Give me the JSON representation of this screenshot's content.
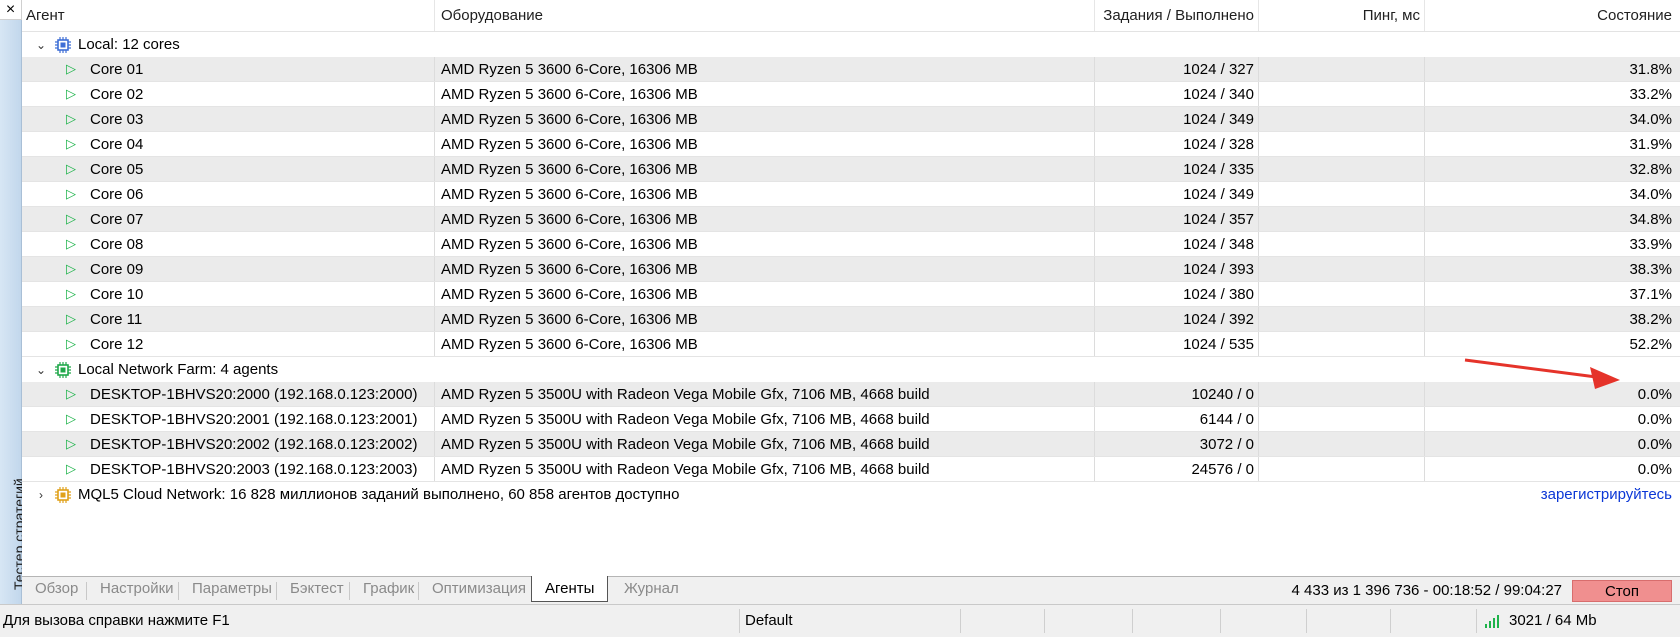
{
  "window": {
    "side_title": "Тестер стратегий",
    "close_glyph": "×"
  },
  "columns": {
    "agent": "Агент",
    "hardware": "Оборудование",
    "jobs": "Задания / Выполнено",
    "ping": "Пинг, мс",
    "state": "Состояние"
  },
  "groups": {
    "local": {
      "label": "Local: 12 cores",
      "icon": "cpu-chip-icon",
      "color": "#3f6fd6"
    },
    "farm": {
      "label": "Local Network Farm: 4 agents",
      "icon": "cpu-chip-icon",
      "color": "#20a84a"
    },
    "cloud": {
      "label": "MQL5 Cloud Network: 16 828 миллионов заданий выполнено, 60 858 агентов доступно",
      "icon": "cpu-chip-icon",
      "color": "#e0a11a",
      "link": "зарегистрируйтесь"
    }
  },
  "local_agents": [
    {
      "name": "Core 01",
      "hw": "AMD Ryzen 5 3600 6-Core, 16306 MB",
      "jobs": "1024 / 327",
      "ping": "",
      "state": "31.8%"
    },
    {
      "name": "Core 02",
      "hw": "AMD Ryzen 5 3600 6-Core, 16306 MB",
      "jobs": "1024 / 340",
      "ping": "",
      "state": "33.2%"
    },
    {
      "name": "Core 03",
      "hw": "AMD Ryzen 5 3600 6-Core, 16306 MB",
      "jobs": "1024 / 349",
      "ping": "",
      "state": "34.0%"
    },
    {
      "name": "Core 04",
      "hw": "AMD Ryzen 5 3600 6-Core, 16306 MB",
      "jobs": "1024 / 328",
      "ping": "",
      "state": "31.9%"
    },
    {
      "name": "Core 05",
      "hw": "AMD Ryzen 5 3600 6-Core, 16306 MB",
      "jobs": "1024 / 335",
      "ping": "",
      "state": "32.8%"
    },
    {
      "name": "Core 06",
      "hw": "AMD Ryzen 5 3600 6-Core, 16306 MB",
      "jobs": "1024 / 349",
      "ping": "",
      "state": "34.0%"
    },
    {
      "name": "Core 07",
      "hw": "AMD Ryzen 5 3600 6-Core, 16306 MB",
      "jobs": "1024 / 357",
      "ping": "",
      "state": "34.8%"
    },
    {
      "name": "Core 08",
      "hw": "AMD Ryzen 5 3600 6-Core, 16306 MB",
      "jobs": "1024 / 348",
      "ping": "",
      "state": "33.9%"
    },
    {
      "name": "Core 09",
      "hw": "AMD Ryzen 5 3600 6-Core, 16306 MB",
      "jobs": "1024 / 393",
      "ping": "",
      "state": "38.3%"
    },
    {
      "name": "Core 10",
      "hw": "AMD Ryzen 5 3600 6-Core, 16306 MB",
      "jobs": "1024 / 380",
      "ping": "",
      "state": "37.1%"
    },
    {
      "name": "Core 11",
      "hw": "AMD Ryzen 5 3600 6-Core, 16306 MB",
      "jobs": "1024 / 392",
      "ping": "",
      "state": "38.2%"
    },
    {
      "name": "Core 12",
      "hw": "AMD Ryzen 5 3600 6-Core, 16306 MB",
      "jobs": "1024 / 535",
      "ping": "",
      "state": "52.2%"
    }
  ],
  "farm_agents": [
    {
      "name": "DESKTOP-1BHVS20:2000 (192.168.0.123:2000)",
      "hw": "AMD Ryzen 5 3500U with Radeon Vega Mobile Gfx, 7106 MB, 4668 build",
      "jobs": "10240 / 0",
      "ping": "",
      "state": "0.0%"
    },
    {
      "name": "DESKTOP-1BHVS20:2001 (192.168.0.123:2001)",
      "hw": "AMD Ryzen 5 3500U with Radeon Vega Mobile Gfx, 7106 MB, 4668 build",
      "jobs": "6144 / 0",
      "ping": "",
      "state": "0.0%"
    },
    {
      "name": "DESKTOP-1BHVS20:2002 (192.168.0.123:2002)",
      "hw": "AMD Ryzen 5 3500U with Radeon Vega Mobile Gfx, 7106 MB, 4668 build",
      "jobs": "3072 / 0",
      "ping": "",
      "state": "0.0%"
    },
    {
      "name": "DESKTOP-1BHVS20:2003 (192.168.0.123:2003)",
      "hw": "AMD Ryzen 5 3500U with Radeon Vega Mobile Gfx, 7106 MB, 4668 build",
      "jobs": "24576 / 0",
      "ping": "",
      "state": "0.0%"
    }
  ],
  "tabs": [
    "Обзор",
    "Настройки",
    "Параметры",
    "Бэктест",
    "График",
    "Оптимизация",
    "Агенты",
    "Журнал"
  ],
  "active_tab": "Агенты",
  "progress": "4 433 из 1 396 736  -  00:18:52 / 99:04:27",
  "stop_label": "Стоп",
  "statusbar": {
    "help": "Для вызова справки нажмите F1",
    "profile": "Default",
    "connection": "3021 / 64 Mb"
  },
  "colors": {
    "accent_arrow": "#e5332a",
    "stop_bg": "#f08f8f",
    "link": "#0b37d6",
    "play": "#1db34a"
  }
}
